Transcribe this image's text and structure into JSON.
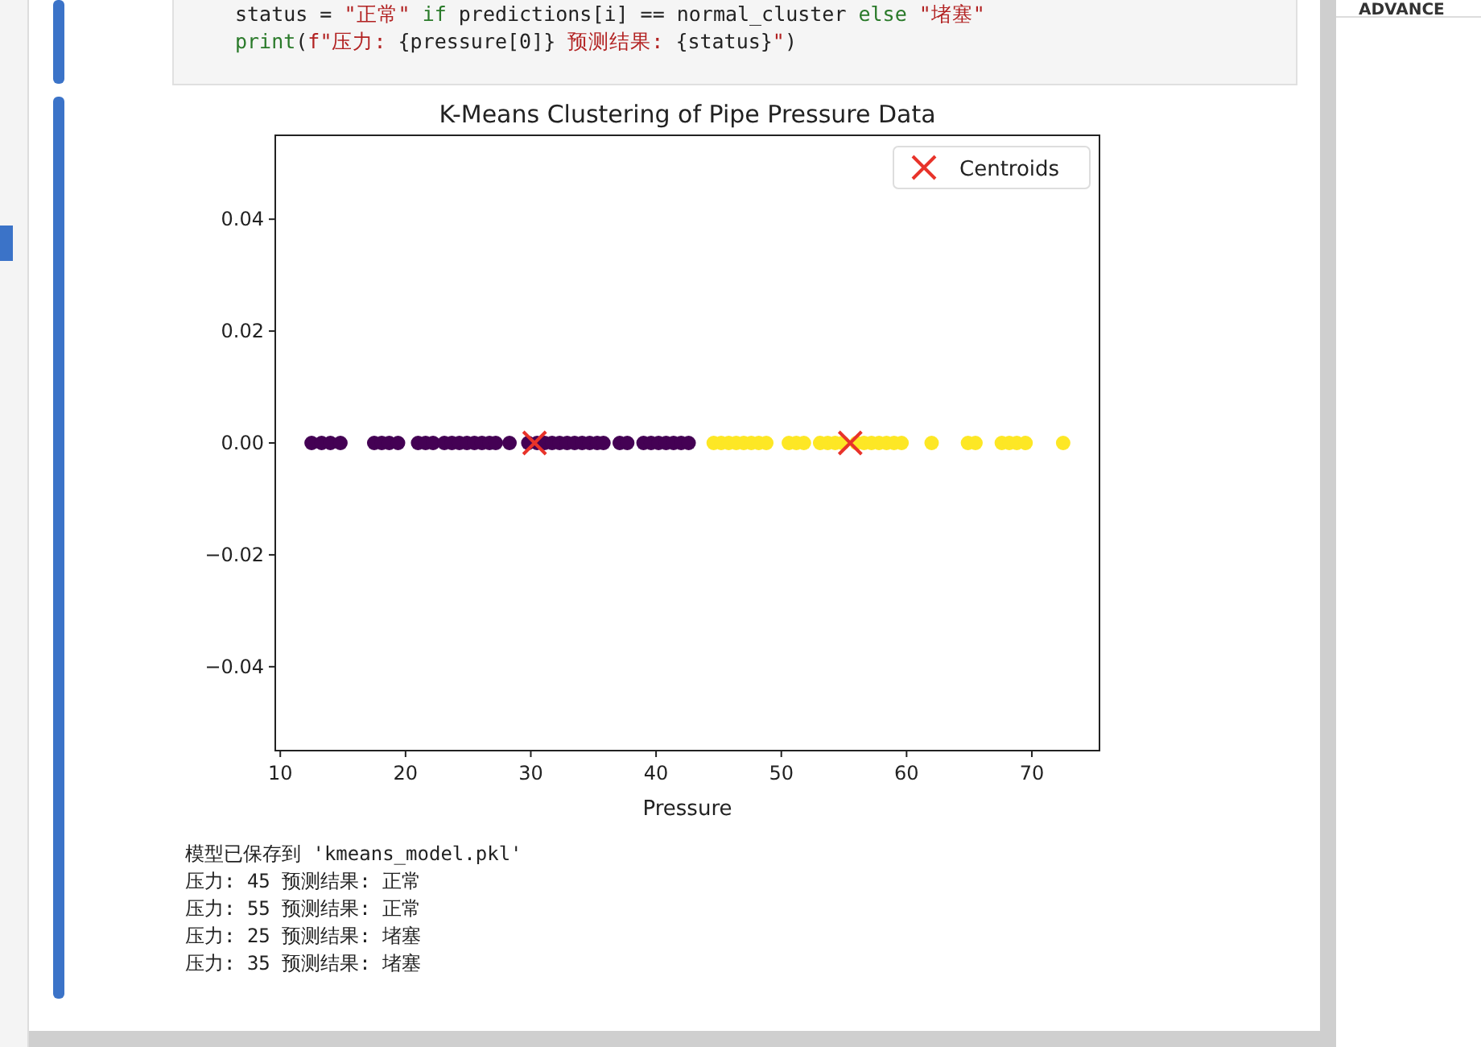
{
  "side_panel": {
    "heading": "ADVANCE"
  },
  "code_cell": {
    "lines": [
      [
        {
          "kind": "plain",
          "text": "status = "
        },
        {
          "kind": "string",
          "text": "\"正常\""
        },
        {
          "kind": "keyword",
          "text": " if "
        },
        {
          "kind": "plain",
          "text": "predictions[i] == normal_cluster"
        },
        {
          "kind": "keyword",
          "text": " else "
        },
        {
          "kind": "string",
          "text": "\"堵塞\""
        }
      ],
      [
        {
          "kind": "builtin",
          "text": "print"
        },
        {
          "kind": "plain",
          "text": "("
        },
        {
          "kind": "string",
          "text": "f\"压力: "
        },
        {
          "kind": "plain",
          "text": "{pressure[0]}"
        },
        {
          "kind": "string",
          "text": " 预测结果: "
        },
        {
          "kind": "plain",
          "text": "{status}"
        },
        {
          "kind": "string",
          "text": "\""
        },
        {
          "kind": "plain",
          "text": ")"
        }
      ]
    ]
  },
  "output": {
    "chart_data": {
      "type": "scatter",
      "title": "K-Means Clustering of Pipe Pressure Data",
      "xlabel": "Pressure",
      "xlim": [
        9.6,
        75.4
      ],
      "ylim": [
        -0.055,
        0.055
      ],
      "xticks": [
        10,
        20,
        30,
        40,
        50,
        60,
        70
      ],
      "yticks": [
        {
          "value": 0.04,
          "label": "0.04"
        },
        {
          "value": 0.02,
          "label": "0.02"
        },
        {
          "value": 0,
          "label": "0.00"
        },
        {
          "value": -0.02,
          "label": "−0.02"
        },
        {
          "value": -0.04,
          "label": "−0.04"
        }
      ],
      "series": [
        {
          "color": "#440154",
          "marker": "dot",
          "x": [
            12.5,
            13.3,
            14,
            14.8,
            17.5,
            18.1,
            18.7,
            19.4,
            21,
            21.6,
            22.2,
            23.1,
            23.7,
            24.3,
            24.9,
            25.5,
            26.1,
            26.7,
            27.2,
            28.3,
            29.8,
            30.5,
            31.1,
            31.7,
            32.3,
            32.9,
            33.5,
            34.1,
            34.7,
            35.3,
            35.8,
            37.1,
            37.7,
            39,
            39.6,
            40.2,
            40.8,
            41.4,
            42,
            42.6
          ],
          "values": [
            0,
            0,
            0,
            0,
            0,
            0,
            0,
            0,
            0,
            0,
            0,
            0,
            0,
            0,
            0,
            0,
            0,
            0,
            0,
            0,
            0,
            0,
            0,
            0,
            0,
            0,
            0,
            0,
            0,
            0,
            0,
            0,
            0,
            0,
            0,
            0,
            0,
            0,
            0,
            0
          ]
        },
        {
          "color": "#fde725",
          "marker": "dot",
          "x": [
            44.6,
            45.2,
            45.8,
            46.4,
            47,
            47.6,
            48.2,
            48.8,
            50.6,
            51.2,
            51.8,
            53.1,
            53.7,
            54.3,
            54.9,
            56,
            56.6,
            57.2,
            57.8,
            58.4,
            59,
            59.6,
            62,
            64.9,
            65.5,
            67.6,
            68.2,
            68.8,
            69.5,
            72.5
          ],
          "values": [
            0,
            0,
            0,
            0,
            0,
            0,
            0,
            0,
            0,
            0,
            0,
            0,
            0,
            0,
            0,
            0,
            0,
            0,
            0,
            0,
            0,
            0,
            0,
            0,
            0,
            0,
            0,
            0,
            0,
            0
          ]
        },
        {
          "name": "Centroids",
          "color": "#e8332a",
          "marker": "cross",
          "x": [
            30.3,
            55.5
          ],
          "values": [
            0,
            0
          ]
        }
      ]
    },
    "log_lines": [
      "模型已保存到 'kmeans_model.pkl'",
      "压力: 45 预测结果: 正常",
      "压力: 55 预测结果: 正常",
      "压力: 25 预测结果: 堵塞",
      "压力: 35 预测结果: 堵塞"
    ]
  }
}
